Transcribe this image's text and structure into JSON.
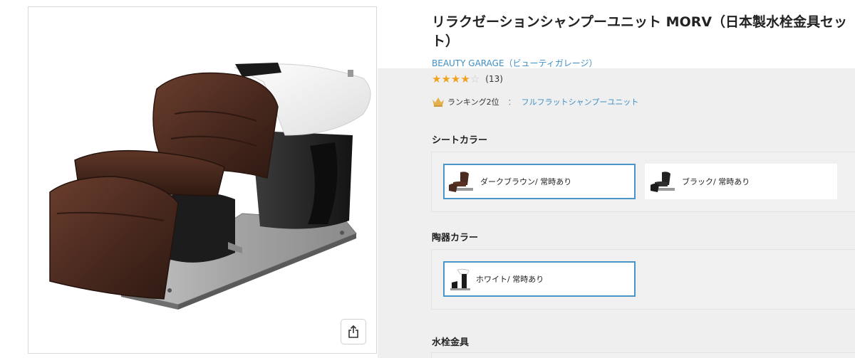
{
  "product": {
    "title": "リラクゼーションシャンプーユニット MORV（日本製水栓金具セット）",
    "brand": "BEAUTY GARAGE（ビューティガレージ）",
    "rating": {
      "value": 4,
      "max": 5,
      "count_text": "(13)"
    },
    "ranking": {
      "label": "ランキング2位",
      "separator": "：",
      "category": "フルフラットシャンプーユニット"
    }
  },
  "icons": {
    "share": "share-icon",
    "crown": "crown-icon",
    "star": "star-icon"
  },
  "colors": {
    "link": "#3d8fc6",
    "star": "#f0a21e",
    "selected_border": "#4a95c8",
    "leather": "#4b2a1f"
  },
  "sections": {
    "seat_color": {
      "heading": "シートカラー",
      "options": [
        {
          "label": "ダークブラウン/ 常時あり",
          "selected": true
        },
        {
          "label": "ブラック/ 常時あり",
          "selected": false
        }
      ]
    },
    "ceramic_color": {
      "heading": "陶器カラー",
      "options": [
        {
          "label": "ホワイト/ 常時あり",
          "selected": true
        }
      ]
    },
    "faucet": {
      "heading": "水栓金具"
    }
  }
}
